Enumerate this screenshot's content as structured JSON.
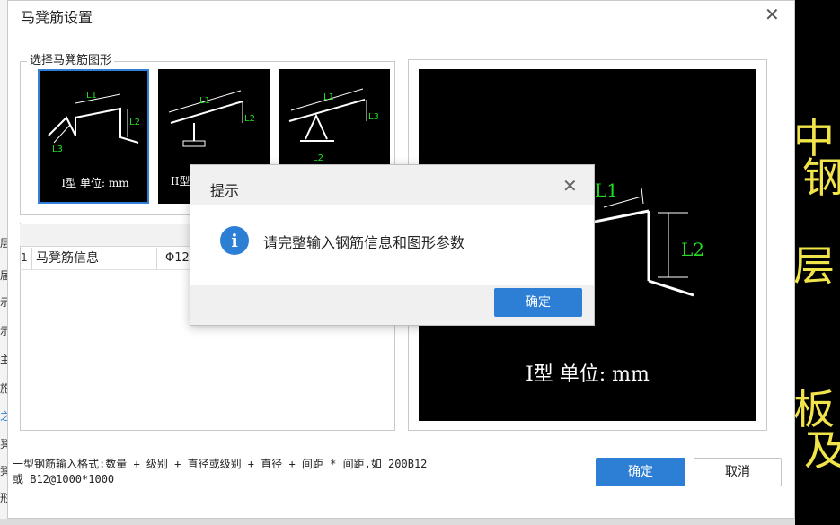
{
  "dialog": {
    "title": "马凳筋设置",
    "close_glyph": "✕"
  },
  "shape_group": {
    "title": "选择马凳筋图形",
    "thumbnails": [
      {
        "label": "I型 单位: mm",
        "selected": true,
        "dims": [
          "L1",
          "L2",
          "L3"
        ]
      },
      {
        "label": "II型",
        "selected": false,
        "dims": [
          "L1",
          "L2"
        ]
      },
      {
        "label": "",
        "selected": false,
        "dims": [
          "L1",
          "L2",
          "L3"
        ]
      }
    ]
  },
  "table": {
    "rows": [
      {
        "num": "1",
        "name": "马凳筋信息",
        "value": "Φ12@"
      }
    ]
  },
  "preview": {
    "label": "I型  单位: mm",
    "dims": [
      "L1",
      "L2"
    ]
  },
  "hint": {
    "line1": "一型钢筋输入格式:数量 + 级别 + 直径或级别 + 直径 + 间距 * 间距,如 200B12",
    "line2": "或 B12@1000*1000"
  },
  "buttons": {
    "ok": "确定",
    "cancel": "取消"
  },
  "message_box": {
    "title": "提示",
    "close_glyph": "✕",
    "icon": "info-icon",
    "text": "请完整输入钢筋信息和图形参数",
    "ok": "确定"
  },
  "background": {
    "left_chars": [
      "层",
      "届",
      "示",
      "示",
      "主",
      "施",
      "之",
      "凳",
      "凳",
      "形"
    ],
    "right_chars": [
      "中",
      "钢",
      "层",
      "板",
      "及"
    ]
  },
  "colors": {
    "accent": "#2d7fd6",
    "cad_text": "#f1e44a",
    "dim_green": "#22dd22"
  }
}
